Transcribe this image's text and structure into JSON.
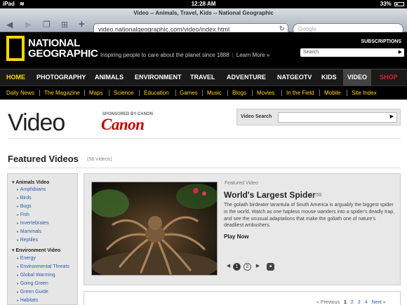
{
  "status_bar": {
    "device": "iPad",
    "time": "12:28 AM",
    "battery": "33%"
  },
  "browser": {
    "page_title": "Video -- Animals, Travel, Kids -- National Geographic",
    "url": "video.nationalgeographic.com/video/index.html",
    "search_placeholder": "Google"
  },
  "header": {
    "logo_line1": "NATIONAL",
    "logo_line2": "GEOGRAPHIC",
    "tagline": "Inspiring people to care about the planet since 1888",
    "learn_more": "Learn More »",
    "subscriptions": "SUBSCRIPTIONS",
    "search_placeholder": "Search"
  },
  "main_nav": [
    "HOME",
    "PHOTOGRAPHY",
    "ANIMALS",
    "ENVIRONMENT",
    "TRAVEL",
    "ADVENTURE",
    "NATGEOTV",
    "KIDS",
    "VIDEO",
    "SHOP"
  ],
  "sub_nav": [
    "Daily News",
    "The Magazine",
    "Maps",
    "Science",
    "Education",
    "Games",
    "Music",
    "Blogs",
    "Movies",
    "In the Field",
    "Mobile",
    "Site Index"
  ],
  "video_page": {
    "title": "Video",
    "sponsored_by": "SPONSORED BY CANON",
    "sponsor_logo": "Canon",
    "video_search_label": "Video Search",
    "featured_heading": "Featured Videos",
    "video_count": "(56 Videos)"
  },
  "sidebar": {
    "section1": "Animals Video",
    "animals": [
      "Amphibians",
      "Birds",
      "Bugs",
      "Fish",
      "Invertebrates",
      "Mammals",
      "Reptiles"
    ],
    "section2": "Environment Video",
    "environment": [
      "Energy",
      "Environmental Threats",
      "Global Warming",
      "Going Green",
      "Green Guide",
      "Habitats"
    ]
  },
  "featured": {
    "label": "Featured Video",
    "title": "World's Largest Spider",
    "duration": "01:55",
    "description": "The goliath birdeater tarantula of South America is arguably the biggest spider in the world. Watch as one hapless mouse wanders into a spider's deadly trap, and see the unusual adaptations that make the goliath one of nature's deadliest ambushers.",
    "play_now": "Play Now",
    "page1": "1",
    "page2": "2"
  },
  "pagination": {
    "prev": "« Previous",
    "p1": "1",
    "p2": "2",
    "p3": "3",
    "p4": "4",
    "next": "Next »"
  }
}
